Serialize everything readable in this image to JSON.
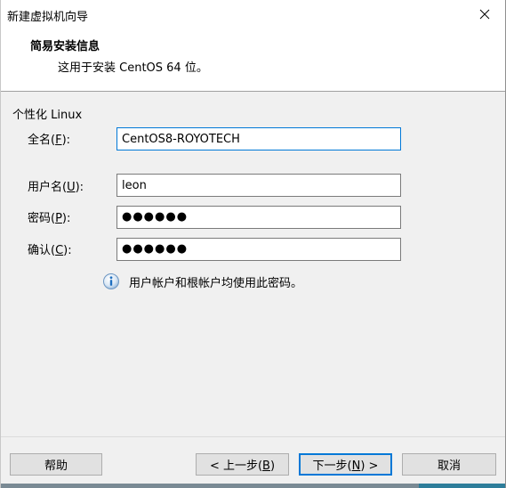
{
  "window": {
    "title": "新建虚拟机向导"
  },
  "header": {
    "title": "简易安装信息",
    "subtitle": "这用于安装 CentOS 64 位。"
  },
  "group": {
    "label": "个性化 Linux"
  },
  "fields": {
    "fullname": {
      "label_pre": "全名(",
      "label_key": "F",
      "label_post": "):",
      "value": "CentOS8-ROYOTECH"
    },
    "username": {
      "label_pre": "用户名(",
      "label_key": "U",
      "label_post": "):",
      "value": "leon"
    },
    "password": {
      "label_pre": "密码(",
      "label_key": "P",
      "label_post": "):",
      "masked": "●●●●●●"
    },
    "confirm": {
      "label_pre": "确认(",
      "label_key": "C",
      "label_post": "):",
      "masked": "●●●●●●"
    }
  },
  "info": {
    "icon": "info-icon",
    "text": "用户帐户和根帐户均使用此密码。"
  },
  "buttons": {
    "help": "帮助",
    "back_pre": "< 上一步(",
    "back_key": "B",
    "back_post": ")",
    "next_pre": "下一步(",
    "next_key": "N",
    "next_post": ") >",
    "cancel": "取消"
  },
  "colors": {
    "focus_border": "#0078d7",
    "info_icon_blue": "#1e6fc0"
  }
}
